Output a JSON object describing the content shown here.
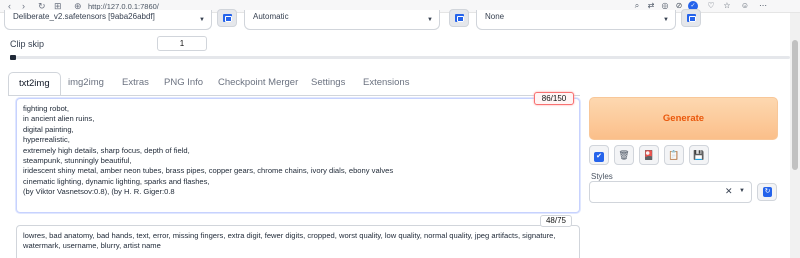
{
  "browser": {
    "url": "http://127.0.0.1:7860/",
    "back_glyph": "‹",
    "forward_glyph": "›",
    "reload_glyph": "↻",
    "apps_glyph": "⊞",
    "site_glyph": "⊕",
    "extensions": [
      "search-icon",
      "translate-icon",
      "camera-icon",
      "security-icon",
      "shield-icon",
      "heart-icon",
      "bookmark-icon",
      "profile-icon",
      "menu-icon"
    ]
  },
  "top": {
    "checkpoint": "Deliberate_v2.safetensors [9aba26abdf]",
    "vae": "Automatic",
    "hypernet": "None"
  },
  "clip_skip": {
    "label": "Clip skip",
    "value": "1",
    "fraction": 0.0
  },
  "tabs": [
    {
      "label": "txt2img",
      "active": true
    },
    {
      "label": "img2img"
    },
    {
      "label": "Extras"
    },
    {
      "label": "PNG Info"
    },
    {
      "label": "Checkpoint Merger"
    },
    {
      "label": "Settings"
    },
    {
      "label": "Extensions"
    }
  ],
  "prompt": {
    "token_count": "86/150",
    "lines": [
      "fighting robot,",
      "in ancient alien ruins,",
      "digital painting,",
      "hyperrealistic,",
      "extremely high details, sharp focus, depth of field,",
      "steampunk, stunningly beautiful,",
      "iridescent shiny metal, amber neon tubes, brass pipes, copper gears, chrome chains, ivory dials, ebony valves",
      "cinematic lighting, dynamic lighting, sparks and flashes,",
      "(by Viktor Vasnetsov:0.8), (by H. R. Giger:0.8"
    ]
  },
  "negative": {
    "token_count": "48/75",
    "lines": [
      "lowres, bad anatomy, bad hands, text, error, missing fingers, extra digit, fewer digits, cropped, worst quality, low quality, normal quality, jpeg artifacts, signature,",
      "watermark, username, blurry, artist name"
    ]
  },
  "right": {
    "generate_label": "Generate",
    "styles_label": "Styles",
    "tools": [
      "interrupt-icon",
      "trash-icon",
      "extra-networks-icon",
      "paste-icon",
      "save-style-icon"
    ],
    "tool_glyphs": [
      "✔",
      "🗑",
      "🎴",
      "📋",
      "💾"
    ]
  },
  "colors": {
    "accent": "#2563eb",
    "generate_text": "#ea580c",
    "generate_bg": "#fbbf8a",
    "counter_warn": "#f87171"
  }
}
